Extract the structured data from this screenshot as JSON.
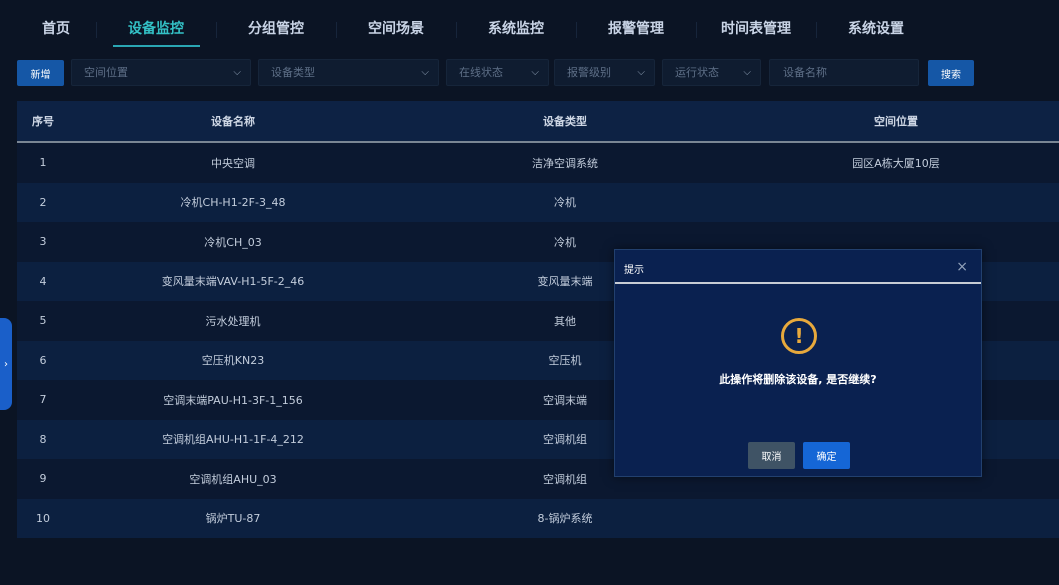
{
  "nav": {
    "tabs": [
      "首页",
      "设备监控",
      "分组管控",
      "空间场景",
      "系统监控",
      "报警管理",
      "时间表管理",
      "系统设置"
    ],
    "active": "设备监控"
  },
  "toolbar": {
    "new_label": "新增",
    "search_label": "搜索",
    "filters": {
      "space": "空间位置",
      "device_type": "设备类型",
      "online_status": "在线状态",
      "alarm_level": "报警级别",
      "run_status": "运行状态",
      "device_name_placeholder": "设备名称"
    }
  },
  "table": {
    "headers": [
      "序号",
      "设备名称",
      "设备类型",
      "空间位置"
    ],
    "rows": [
      [
        "1",
        "中央空调",
        "洁净空调系统",
        "园区A栋大厦10层"
      ],
      [
        "2",
        "冷机CH-H1-2F-3_48",
        "冷机",
        ""
      ],
      [
        "3",
        "冷机CH_03",
        "冷机",
        ""
      ],
      [
        "4",
        "变风量末端VAV-H1-5F-2_46",
        "变风量末端",
        ""
      ],
      [
        "5",
        "污水处理机",
        "其他",
        ""
      ],
      [
        "6",
        "空压机KN23",
        "空压机",
        ""
      ],
      [
        "7",
        "空调末端PAU-H1-3F-1_156",
        "空调末端",
        ""
      ],
      [
        "8",
        "空调机组AHU-H1-1F-4_212",
        "空调机组",
        ""
      ],
      [
        "9",
        "空调机组AHU_03",
        "空调机组",
        ""
      ],
      [
        "10",
        "锅炉TU-87",
        "8-锅炉系统",
        ""
      ]
    ]
  },
  "dialog": {
    "title": "提示",
    "message": "此操作将删除该设备, 是否继续?",
    "cancel_label": "取消",
    "ok_label": "确定",
    "icon": "warning-icon",
    "icon_glyph": "!",
    "close_glyph": "×"
  },
  "side_handle": {
    "glyph": "›"
  },
  "colors": {
    "accent": "#33c1c6",
    "primary_button": "#1566d6",
    "warning": "#e8a93c",
    "background": "#0b1424"
  }
}
